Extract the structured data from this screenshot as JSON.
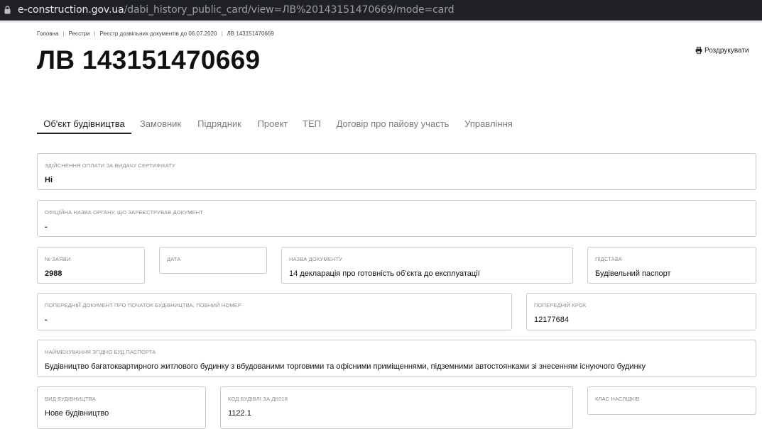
{
  "browser": {
    "url_host": "e-construction.gov.ua",
    "url_path": "/dabi_history_public_card/view=ЛВ%20143151470669/mode=card"
  },
  "breadcrumb": [
    "Головна",
    "Реєстри",
    "Реєстр дозвільних документів до 06.07.2020",
    "ЛВ 143151470669"
  ],
  "page": {
    "title": "ЛВ 143151470669",
    "print_label": "Роздрукувати"
  },
  "tabs": [
    "Об'єкт будівництва",
    "Замовник",
    "Підрядник",
    "Проект",
    "ТЕП",
    "Договір про пайову участь",
    "Управління"
  ],
  "fields": {
    "payment": {
      "label": "Здійснення оплати за видачу сертифікату",
      "value": "Ні"
    },
    "official_body": {
      "label": "Офіційна назва органу, що зареєстрував документ",
      "value": "-"
    },
    "application_no": {
      "label": "№ заяви",
      "value": "2988"
    },
    "date": {
      "label": "Дата",
      "value": ""
    },
    "document_name": {
      "label": "Назва документу",
      "value": "14 декларація про готовність об'єкта до експлуатації"
    },
    "basis": {
      "label": "Підстава",
      "value": "Будівельний паспорт"
    },
    "previous_doc": {
      "label": "Попередній документ про початок будівництва, повний номер",
      "value": "-"
    },
    "previous_step": {
      "label": "Попередній крок",
      "value": "12177684"
    },
    "name_by_passport": {
      "label": "Найменування згідно буд.паспорта",
      "value": "Будівництво багатоквартирного житлового будинку з вбудованими торговими та офісними приміщеннями, підземними автостоянками зі знесенням існуючого будинку"
    },
    "construction_type": {
      "label": "Вид будівництва",
      "value": "Нове будівництво"
    },
    "building_code": {
      "label": "Код будівлі за ДК018",
      "value": "1122.1"
    },
    "consequence_class": {
      "label": "Клас наслідків",
      "value": ""
    }
  }
}
